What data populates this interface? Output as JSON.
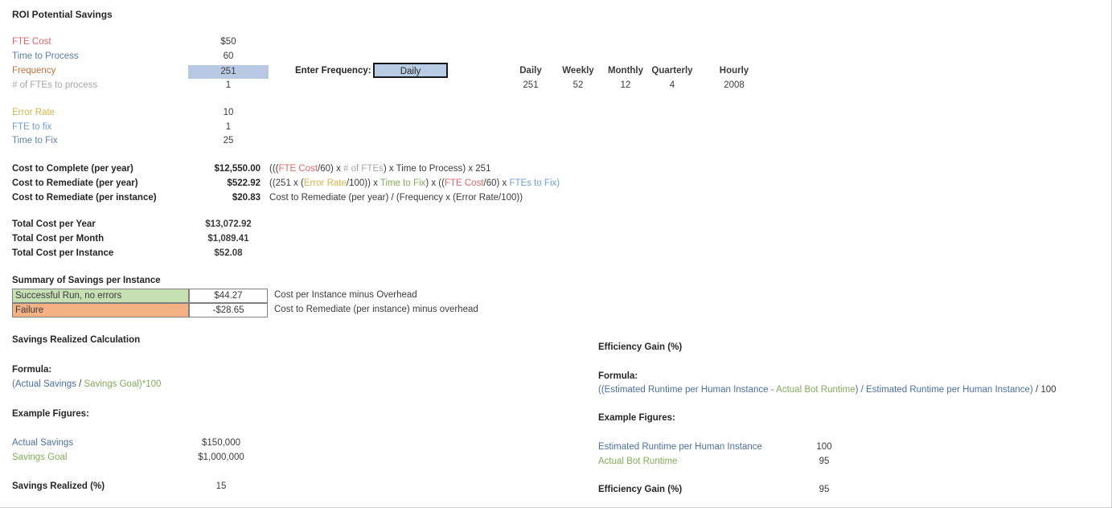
{
  "title": "ROI Potential Savings",
  "inputs": {
    "rows": [
      {
        "label": "FTE Cost",
        "value": "$50"
      },
      {
        "label": "Time to Process",
        "value": "60"
      },
      {
        "label": "Frequency",
        "value": "251"
      },
      {
        "label": "# of FTEs to process",
        "value": "1"
      },
      {
        "label": "Error Rate",
        "value": "10"
      },
      {
        "label": "FTE to fix",
        "value": "1"
      },
      {
        "label": "Time to Fix",
        "value": "25"
      }
    ]
  },
  "frequency_selector": {
    "prompt": "Enter Frequency:",
    "selected": "Daily",
    "options": [
      "Daily",
      "Weekly",
      "Monthly",
      "Quarterly",
      "Hourly"
    ]
  },
  "frequency_table": {
    "headers": [
      "Daily",
      "Weekly",
      "Monthly",
      "Quarterly",
      "Hourly"
    ],
    "values": [
      "251",
      "52",
      "12",
      "4",
      "2008"
    ]
  },
  "costs": {
    "rows": [
      {
        "label": "Cost to Complete (per year)",
        "value": "$12,550.00",
        "formula": [
          {
            "t": "(((",
            "c": "dark"
          },
          {
            "t": "FTE Cost",
            "c": "red"
          },
          {
            "t": "/60) x ",
            "c": "dark"
          },
          {
            "t": "# of FTEs",
            "c": "gray"
          },
          {
            "t": ") x ",
            "c": "dark"
          },
          {
            "t": "Time to Process",
            "c": "dark"
          },
          {
            "t": ") x 251",
            "c": "dark"
          }
        ]
      },
      {
        "label": "Cost to Remediate (per year)",
        "value": "$522.92",
        "formula": [
          {
            "t": "((251 x (",
            "c": "dark"
          },
          {
            "t": "Error Rate",
            "c": "gold"
          },
          {
            "t": "/100)) x ",
            "c": "dark"
          },
          {
            "t": "Time to Fix",
            "c": "green"
          },
          {
            "t": ") x ((",
            "c": "dark"
          },
          {
            "t": "FTE Cost",
            "c": "red"
          },
          {
            "t": "/60) x ",
            "c": "dark"
          },
          {
            "t": "FTEs to Fix",
            "c": "blue2"
          },
          {
            "t": ")",
            "c": "blue2"
          }
        ]
      },
      {
        "label": "Cost to Remediate (per instance)",
        "value": "$20.83",
        "formula": [
          {
            "t": "Cost to Remediate (per year) / (Frequency x (Error Rate/100))",
            "c": "dark"
          }
        ]
      }
    ]
  },
  "totals": {
    "rows": [
      {
        "label": "Total Cost per Year",
        "value": "$13,072.92"
      },
      {
        "label": "Total Cost per Month",
        "value": "$1,089.41"
      },
      {
        "label": "Total Cost per Instance",
        "value": "$52.08"
      }
    ]
  },
  "summary": {
    "heading": "Summary of Savings per Instance",
    "rows": [
      {
        "label": "Successful Run, no errors",
        "amount": "$44.27",
        "description": "Cost per Instance minus Overhead"
      },
      {
        "label": "Failure",
        "amount": "-$28.65",
        "description": "Cost to Remediate (per instance) minus overhead"
      }
    ]
  },
  "savings_section": {
    "heading": "Savings Realized Calculation",
    "formula_label": "Formula:",
    "formula": [
      {
        "t": "(Actual Savings",
        "c": "navy"
      },
      {
        "t": " / ",
        "c": "dark"
      },
      {
        "t": "Savings Goal)*100",
        "c": "green"
      }
    ],
    "example_label": "Example Figures:",
    "examples": [
      {
        "label": "Actual Savings",
        "color": "navy",
        "value": "$150,000"
      },
      {
        "label": "Savings Goal",
        "color": "green",
        "value": "$1,000,000"
      }
    ],
    "result_label": "Savings Realized (%)",
    "result_value": "15"
  },
  "efficiency_section": {
    "heading": "Efficiency Gain (%)",
    "formula_label": "Formula:",
    "formula": [
      {
        "t": "((Estimated Runtime per Human Instance - ",
        "c": "navy"
      },
      {
        "t": "Actual Bot Runtime",
        "c": "green"
      },
      {
        "t": ") / ",
        "c": "navy"
      },
      {
        "t": "Estimated Runtime per Human Instance",
        "c": "navy"
      },
      {
        "t": ")",
        "c": "navy"
      },
      {
        "t": " / 100",
        "c": "dark"
      }
    ],
    "example_label": "Example Figures:",
    "examples": [
      {
        "label": "Estimated Runtime per Human Instance",
        "color": "navy",
        "value": "100"
      },
      {
        "label": "Actual Bot Runtime",
        "color": "green",
        "value": "95"
      }
    ],
    "result_label": "Efficiency Gain (%)",
    "result_value": "95"
  },
  "colors": {
    "fte_cost": "#e06666",
    "time_to_process": "#5a7ca8",
    "frequency": "#c2703a",
    "num_ftes": "#a6a6a6",
    "error_rate": "#d8b54a",
    "fte_to_fix": "#6d9ed1",
    "time_to_fix": "#5f83ad",
    "highlight": "#b9c9e3",
    "button": "#b8cce4",
    "success_row": "#c6e0b4",
    "failure_row": "#f4b183",
    "navy": "#4a6fa5",
    "green": "#82ab5a"
  }
}
